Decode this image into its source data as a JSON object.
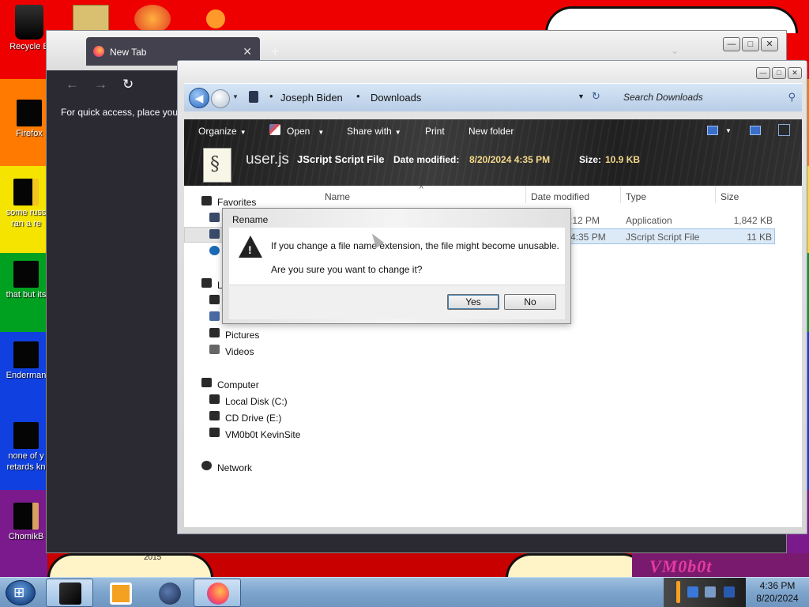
{
  "desktop": {
    "stripe_colors": [
      "#ee0000",
      "#ff7a00",
      "#f4e400",
      "#00a020",
      "#1040e0",
      "#7a1a8c"
    ],
    "wallpaper_text": "VM0b0t",
    "wallpaper_year": "2015",
    "icons": [
      {
        "label": "Recycle B",
        "icon": "recycle-bin-icon"
      },
      {
        "label": "Firefox",
        "icon": "firefox-icon"
      },
      {
        "label": "some russ",
        "label2": "ran a re",
        "icon": "file-icon"
      },
      {
        "label": "that but its",
        "icon": "file-icon"
      },
      {
        "label": "Enderman",
        "icon": "program-icon"
      },
      {
        "label": "none of y",
        "label2": "retards kn",
        "icon": "file-icon"
      },
      {
        "label": "ChomikB",
        "icon": "program-icon"
      }
    ]
  },
  "browser": {
    "tab_title": "New Tab",
    "tab_close": "✕",
    "new_tab": "+",
    "back": "←",
    "forward": "→",
    "reload": "↻",
    "bookmarks_message": "For quick access, place your"
  },
  "window_controls": {
    "minimize": "—",
    "maximize": "□",
    "close": "✕"
  },
  "explorer": {
    "back": "◀",
    "history_caret": "▼",
    "breadcrumb": [
      "Joseph Biden",
      "Downloads"
    ],
    "breadcrumb_separator": "•",
    "address_dropdown": "▼",
    "refresh": "↻",
    "search_placeholder": "Search Downloads",
    "search_icon_glyph": "⚲",
    "toolbar": {
      "organize": "Organize",
      "open": "Open",
      "share_with": "Share with",
      "print": "Print",
      "new_folder": "New folder",
      "caret": "▼"
    },
    "details": {
      "file_name": "user.js",
      "file_type": "JScript Script File",
      "date_modified_label": "Date modified:",
      "date_modified_value": "8/20/2024 4:35 PM",
      "size_label": "Size:",
      "size_value": "10.9 KB"
    },
    "nav": {
      "favorites": "Favorites",
      "libraries_partial": "L",
      "pictures": "Pictures",
      "videos": "Videos",
      "computer": "Computer",
      "local_disk": "Local Disk (C:)",
      "cd_drive": "CD Drive (E:)",
      "network_drive": "VM0b0t KevinSite",
      "network": "Network"
    },
    "columns": {
      "name": "Name",
      "date_modified": "Date modified",
      "type": "Type",
      "size": "Size",
      "sort_indicator": "^"
    },
    "files": [
      {
        "date": ":12 PM",
        "type": "Application",
        "size": "1,842 KB",
        "selected": false
      },
      {
        "date": "4:35 PM",
        "type": "JScript Script File",
        "size": "11 KB",
        "selected": true
      }
    ]
  },
  "dialog": {
    "title": "Rename",
    "warning_glyph": "!",
    "message": "If you change a file name extension, the file might become unusable.",
    "question": "Are you sure you want to change it?",
    "yes": "Yes",
    "no": "No"
  },
  "taskbar": {
    "time": "4:36 PM",
    "date": "8/20/2024"
  }
}
